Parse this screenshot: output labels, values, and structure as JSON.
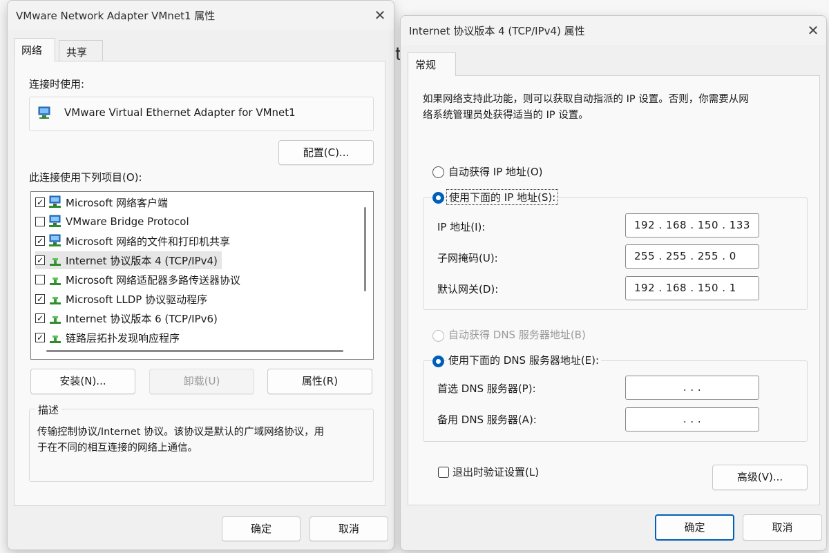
{
  "left_dialog": {
    "title": "VMware Network Adapter VMnet1 属性",
    "tabs": [
      "网络",
      "共享"
    ],
    "connect_using_label": "连接时使用:",
    "adapter_name": "VMware Virtual Ethernet Adapter for VMnet1",
    "configure_button": "配置(C)...",
    "items_label": "此连接使用下列项目(O):",
    "items": [
      {
        "label": "Microsoft 网络客户端",
        "checked": true,
        "icon": "network-client-icon"
      },
      {
        "label": "VMware Bridge Protocol",
        "checked": false,
        "icon": "network-protocol-icon"
      },
      {
        "label": "Microsoft 网络的文件和打印机共享",
        "checked": true,
        "icon": "network-client-icon"
      },
      {
        "label": "Internet 协议版本 4 (TCP/IPv4)",
        "checked": true,
        "icon": "protocol-icon"
      },
      {
        "label": "Microsoft 网络适配器多路传送器协议",
        "checked": false,
        "icon": "protocol-icon"
      },
      {
        "label": "Microsoft LLDP 协议驱动程序",
        "checked": true,
        "icon": "protocol-icon"
      },
      {
        "label": "Internet 协议版本 6 (TCP/IPv6)",
        "checked": true,
        "icon": "protocol-icon"
      },
      {
        "label": "链路层拓扑发现响应程序",
        "checked": true,
        "icon": "protocol-icon"
      }
    ],
    "install_button": "安装(N)...",
    "uninstall_button": "卸载(U)",
    "properties_button": "属性(R)",
    "description_label": "描述",
    "description_text_line1": "传输控制协议/Internet 协议。该协议是默认的广域网络协议，用",
    "description_text_line2": "于在不同的相互连接的网络上通信。",
    "ok_button": "确定",
    "cancel_button": "取消"
  },
  "right_dialog": {
    "title": "Internet 协议版本 4 (TCP/IPv4) 属性",
    "tab": "常规",
    "intro_line1": "如果网络支持此功能，则可以获取自动指派的 IP 设置。否则，你需要从网",
    "intro_line2": "络系统管理员处获得适当的 IP 设置。",
    "auto_ip_label": "自动获得 IP 地址(O)",
    "manual_ip_label": "使用下面的 IP 地址(S):",
    "ip_label": "IP 地址(I):",
    "ip_value": "192 . 168 . 150 . 133",
    "mask_label": "子网掩码(U):",
    "mask_value": "255 . 255 . 255 .  0",
    "gateway_label": "默认网关(D):",
    "gateway_value": "192 . 168 . 150 .  1",
    "auto_dns_label": "自动获得 DNS 服务器地址(B)",
    "manual_dns_label": "使用下面的 DNS 服务器地址(E):",
    "preferred_dns_label": "首选 DNS 服务器(P):",
    "preferred_dns_value": ".      .      .",
    "alternate_dns_label": "备用 DNS 服务器(A):",
    "alternate_dns_value": ".      .      .",
    "validate_label": "退出时验证设置(L)",
    "advanced_button": "高级(V)...",
    "ok_button": "确定",
    "cancel_button": "取消"
  },
  "colors": {
    "accent": "#005fb8"
  }
}
